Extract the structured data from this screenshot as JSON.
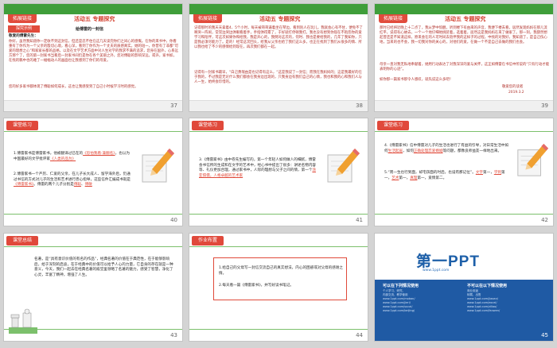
{
  "slides": {
    "s37": {
      "tag": "拓展链接",
      "activity": "活动五 专题探究",
      "label": "探究示例",
      "subtitle": "给傅雷的一封信",
      "greeting": "敬爱的傅雷先生：",
      "text": "你好，虽然我知道你一定收不到这封信，但还是忍不住在这几天读完你们之间心的感慨。在你的来书中，你看重有了你作为一个父亲的殷切心境，看心深，看到了你作为一个丈夫的质感真实。她的短一，你曾有了非都“可爱的理想之心”和家家长都的品格，以及在文学艺术方面中对人生对学的我求不满的追求，您身在国外，心系远方那个了，您的第一封家书当看后一封家书间仍是你在各个美丽之外，您对傅聪的影响深远，或许，家书如，在找的稿中也的难了一幅幅动人的画面也让我感到了你们的母爱。",
      "text2": "您的好多家书都体现了傅聪如何成长，这也让我感受到了自己小时候学习时的感觉。",
      "page": "37"
    },
    "s38": {
      "tag": "拓展链接",
      "activity": "活动五 专题探究",
      "text": "记得那时的我天天拿着4、5个小时，每天被哥哥逼着坐在琴边，看到别人在玩儿，我就会心有不甘，便免不了啊哭一阵闹，常常边哭边弹眼看着手，手指弹得累了，于好就打停顿我打。我也没有想到你现在不抱怨你的爱学习和陪伴，可这次如果你和给我，我是开心的，我倒对这次的，何时、我也是要给我的，几年了我知你，只是我必须尽能力了。是的！经常这次回头，给我从父亲也给了我们这么多，也正在找到了我们从很多的情、所以我也给了不少的感情给到现在，再次我们都在一起。",
      "text2": "记得有一封家书最早，“白己勇哉由是也记得有这么，“这是我说了一封信；而我在我妈妈的；这是我最好的在于我的，不过我是无论什么我们都会在我身边出现的，只我身边有我们自己的心情，我也和我的心和我们人与人一生，始终会珍惜的。",
      "page": "38"
    },
    "s39": {
      "tag": "拓展链接",
      "activity": "活动五 专题探究",
      "text": "那时已经将近晚上十二点了，我从梦中惊醒，听到楼下有由来的声音，我便下楼去看，居然发现妈妈在那儿流红平，说得有心故去，一个一个地仔细地挑装着，选着着，居然这是我妈妈在来了做家了。那一刻，我骤然想起曾还是不知道这样，原来会在的人可时间去陪伴我的这样子的过程，中找的对我好，我知道了，是自己伤心地，当来的也不会，我一切我对你的关心的，对他们的爱，在做一个不是自己去做的我们也会。",
      "text2": "母亲一直对我无私地奉献着，她用行动表达了对我深深的爱与关怀，这正如傅雷在书信中所说的“只有行动才能表明你的心迹”。",
      "text3": "如你那一篇家书那令人感叹，就先说这么多吧！",
      "sign": "敬爱您的读者",
      "date": "2019.3.2",
      "page": "39"
    },
    "s40": {
      "tag": "课堂练习",
      "q1": "1.傅雷家书是傅雷家书，他被翻译过已在的",
      "q1_blank": "《恐怕我看·兼翻名》",
      "q1_end": "，",
      "q1b": "也以为中国最好的文学批评家",
      "q1b_blank": "《人类的品为》",
      "q2": "2.傅雷家书一个严厉、仁爱的父亲，在儿子长大成人、留学海外后，仍通过书信的方式对儿子的生活和艺术进行悉心指导，这些信件汇编成书就是",
      "q2_blank": "《傅雷家书》",
      "q2_end": "。傅雷的两个儿子分别是",
      "q2_blank2": "傅聪",
      "q2_blank3": "傅敏",
      "page": "40"
    },
    "s41": {
      "tag": "课堂练习",
      "q3": "3.《傅雷家书》由中卷先生编写的，第一个年轻人如何做人的细腻，傅雷会书信所的生成和在文字的艺术中，经心书中提出了很多：讲述名物内容等、礼仪更加合理，通过家书中，人际的理想与父子之间的情，第一个",
      "q3_blank": "涂亚俱儒，人格卓越的艺术家",
      "page": "41"
    },
    "s42": {
      "tag": "课堂练习",
      "q4": "4.《傅雷家书》信中傅雷对儿子的生活也进行了有益的引导，对日常生活中如何",
      "q4_blank1": "生活起居",
      "q4_mid": "，如何",
      "q4_blank2": "正确处理恋爱婚姻",
      "q4_mid2": "等问题，都像良师益友一样地出来。",
      "q5": "5.“周一生也行到面，却宅孩面的时后，也设有那记位”。",
      "q5_blank1": "文字",
      "q5_blank2": "学到",
      "q5_blank3": "艺术",
      "q5_blank4": "真理",
      "q5_end": "，爱情第二。",
      "page": "42"
    },
    "s43": {
      "tag": "课堂总结",
      "text": "名著，是“具有意识价值的有名的作品”，经典名著的价值在于典范性，在于能够影响后，给于深刻的启迪，在于经典中的价值可以给予人心的力量，它自身的存在就是一种意义，今天，我们一起去在经典名著的殿堂里领略了名著的魅力，感受了智慧，净化了心灵，丰富了精神，增强了人生。",
      "page": "43"
    },
    "s44": {
      "tag": "作业布置",
      "hw1": "1.给自己的父母写一封信交流自己的真实想法，内心的困惑或对父母的感谢之情。",
      "hw2": "2.每天看一篇《傅雷家书》，并写好读书笔记。",
      "page": "44"
    },
    "s45": {
      "logo": "第一PPT",
      "logo_sub": "www.1ppt.com",
      "col1_title": "可以在下列情况使用",
      "col2_title": "不可以在以下情况使用",
      "col1_items": [
        "个人学习、研究、",
        "内部交流、教学使用",
        "www.1ppt.com/moban/",
        "www.1ppt.com/jieri/",
        "www.1ppt.com/sucai/",
        "www.1ppt.com/beijing/"
      ],
      "col2_items": [
        "商业用途",
        "转载、出售",
        "www.1ppt.com/jiaoan/",
        "www.1ppt.com/excel/",
        "www.1ppt.com/ziliao/",
        "www.1ppt.com/fanwen/"
      ],
      "page": "45"
    }
  }
}
